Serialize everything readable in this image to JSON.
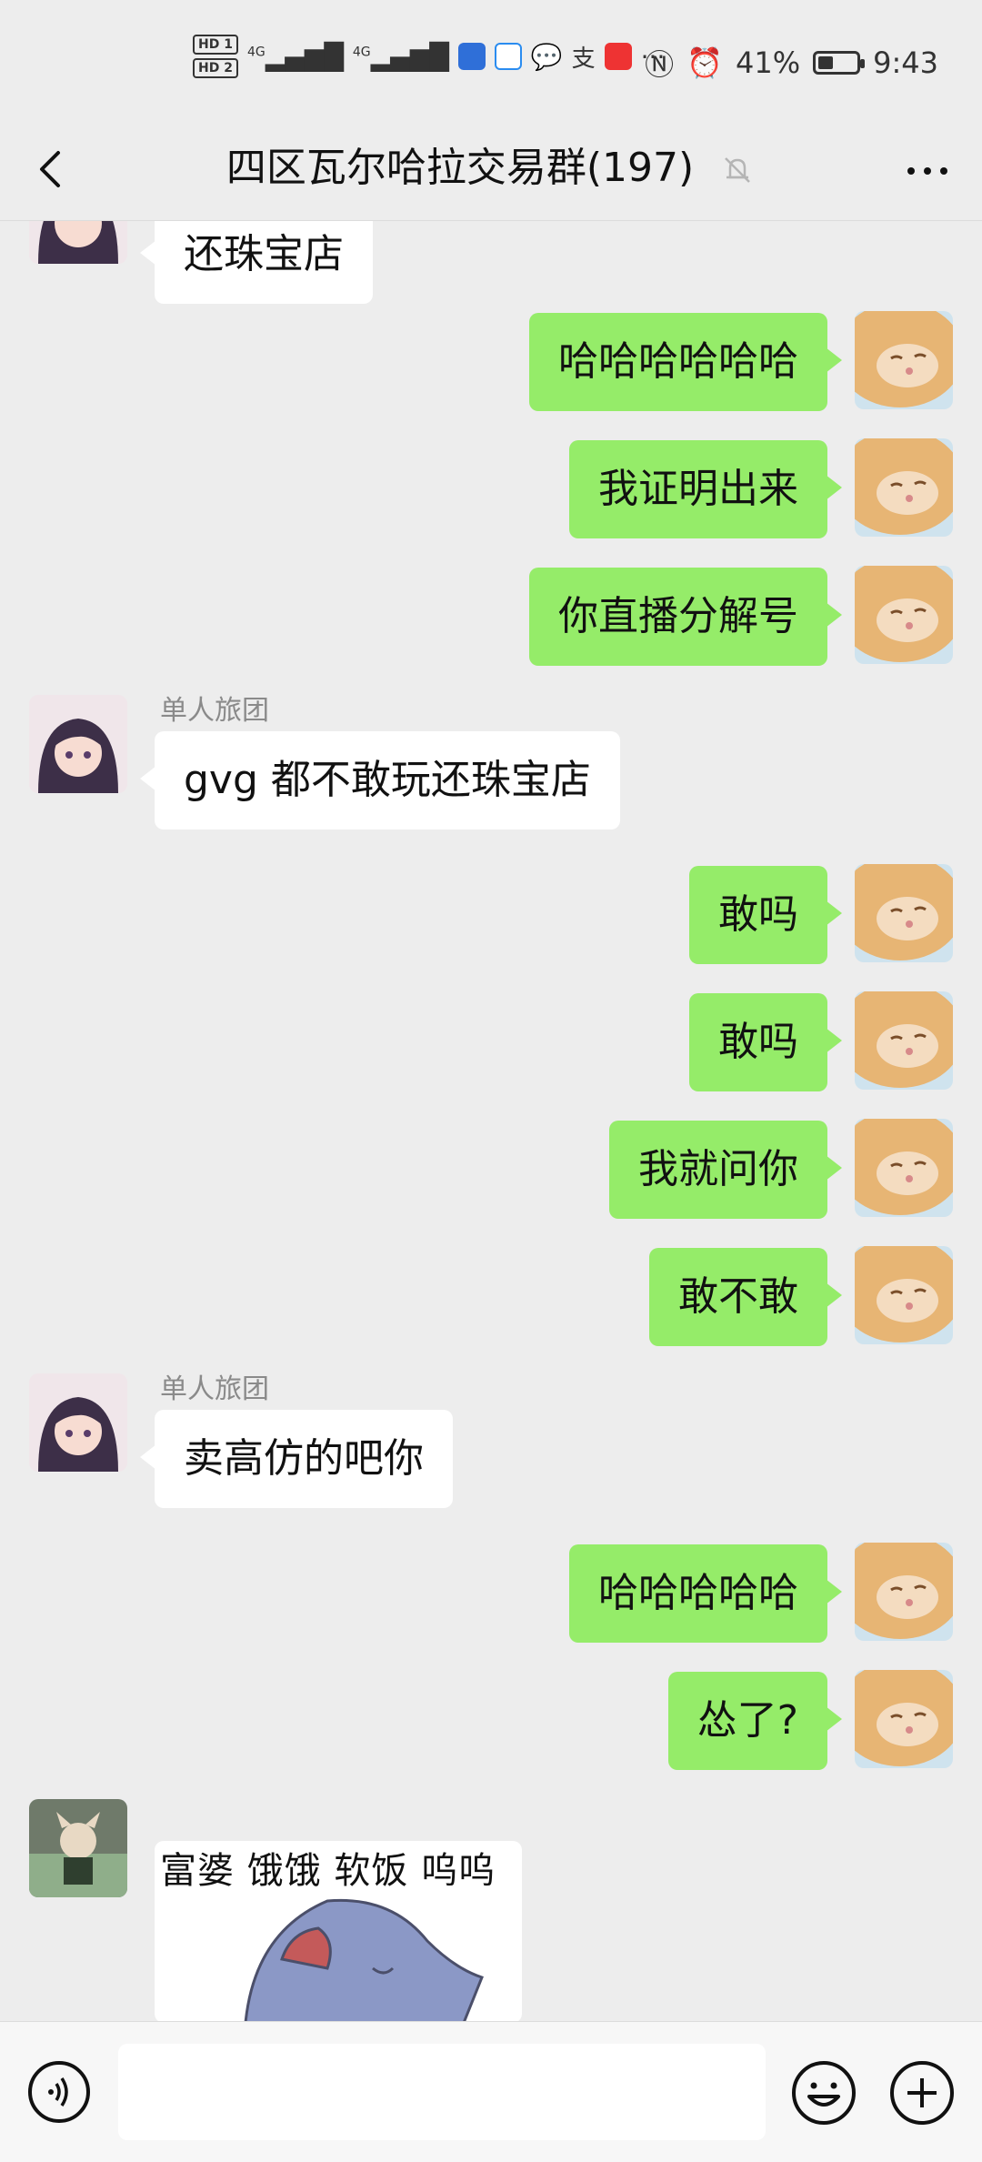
{
  "status_bar": {
    "hd1": "HD 1",
    "hd2": "HD 2",
    "net1": "4G",
    "net2": "4G",
    "battery_percent": "41%",
    "battery_level": 0.41,
    "time": "9:43",
    "more_notifications": "···"
  },
  "header": {
    "title": "四区瓦尔哈拉交易群(197)",
    "back_icon": "chevron-left-icon",
    "mute_icon": "bell-off-icon",
    "more_icon": "more-dots-icon"
  },
  "messages": [
    {
      "from": "them",
      "text": "还珠宝店"
    },
    {
      "from": "me",
      "text": "哈哈哈哈哈哈"
    },
    {
      "from": "me",
      "text": "我证明出来"
    },
    {
      "from": "me",
      "text": "你直播分解号"
    },
    {
      "from": "them",
      "sender": "单人旅团",
      "text": "gvg 都不敢玩还珠宝店"
    },
    {
      "from": "me",
      "text": "敢吗"
    },
    {
      "from": "me",
      "text": "敢吗"
    },
    {
      "from": "me",
      "text": "我就问你"
    },
    {
      "from": "me",
      "text": "敢不敢"
    },
    {
      "from": "them",
      "sender": "单人旅团",
      "text": "卖高仿的吧你"
    },
    {
      "from": "me",
      "text": "哈哈哈哈哈"
    },
    {
      "from": "me",
      "text": "怂了?"
    },
    {
      "from": "them",
      "type": "sticker",
      "text": "富婆 饿饿 软饭 呜呜"
    }
  ],
  "input_bar": {
    "voice_icon": "voice-icon",
    "placeholder": "",
    "emoji_icon": "emoji-icon",
    "plus_icon": "plus-icon"
  },
  "colors": {
    "background": "#ededed",
    "my_bubble": "#95ec69",
    "their_bubble": "#ffffff",
    "sender_name": "#8a8a8a"
  }
}
